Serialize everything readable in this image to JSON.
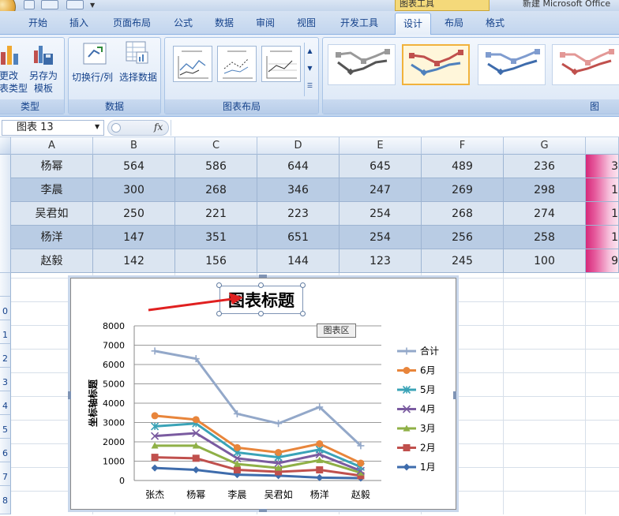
{
  "window": {
    "doc_title_fragment": "图表工具",
    "app_title_fragment": "新建 Microsoft Office"
  },
  "tabs": [
    {
      "label": "开始"
    },
    {
      "label": "插入"
    },
    {
      "label": "页面布局"
    },
    {
      "label": "公式"
    },
    {
      "label": "数据"
    },
    {
      "label": "审阅"
    },
    {
      "label": "视图"
    },
    {
      "label": "开发工具"
    },
    {
      "label": "设计",
      "active": true
    },
    {
      "label": "布局"
    },
    {
      "label": "格式"
    }
  ],
  "ribbon": {
    "type_group": {
      "label": "类型",
      "change_type_line1": "更改",
      "change_type_line2": "表类型",
      "save_template_line1": "另存为",
      "save_template_line2": "模板"
    },
    "data_group": {
      "label": "数据",
      "switch_row_col": "切换行/列",
      "select_data": "选择数据"
    },
    "layout_group": {
      "label": "图表布局"
    },
    "style_group": {
      "label_fragment": "图"
    }
  },
  "formula_bar": {
    "name_box": "图表 13",
    "fx": "fx"
  },
  "sheet": {
    "columns": [
      "A",
      "B",
      "C",
      "D",
      "E",
      "F",
      "G"
    ],
    "row_numbers": [
      "0",
      "1",
      "2",
      "3",
      "4",
      "5",
      "6",
      "7",
      "8"
    ],
    "rows": [
      {
        "name": "杨幂",
        "values": [
          "564",
          "586",
          "644",
          "645",
          "489",
          "236"
        ],
        "partial": "3"
      },
      {
        "name": "李晨",
        "values": [
          "300",
          "268",
          "346",
          "247",
          "269",
          "298"
        ],
        "partial": "1"
      },
      {
        "name": "吴君如",
        "values": [
          "250",
          "221",
          "223",
          "254",
          "268",
          "274"
        ],
        "partial": "1"
      },
      {
        "name": "杨洋",
        "values": [
          "147",
          "351",
          "651",
          "254",
          "256",
          "258"
        ],
        "partial": "1"
      },
      {
        "name": "赵毅",
        "values": [
          "142",
          "156",
          "144",
          "123",
          "245",
          "100"
        ],
        "partial": "9"
      }
    ]
  },
  "chart_tooltip": "图表区",
  "chart_data": {
    "type": "line",
    "title": "图表标题",
    "xlabel": "",
    "ylabel": "坐标轴标题",
    "ylim": [
      0,
      8000
    ],
    "yticks": [
      "0",
      "1000",
      "2000",
      "3000",
      "4000",
      "5000",
      "6000",
      "7000",
      "8000"
    ],
    "categories": [
      "张杰",
      "杨幂",
      "李晨",
      "吴君如",
      "杨洋",
      "赵毅"
    ],
    "grid": true,
    "legend": "right",
    "series": [
      {
        "name": "合计",
        "color": "#93a8c9",
        "marker": "plus",
        "values": [
          6700,
          6300,
          3450,
          2950,
          3800,
          1800
        ]
      },
      {
        "name": "6月",
        "color": "#e8853b",
        "marker": "circle",
        "values": [
          3350,
          3150,
          1700,
          1450,
          1900,
          900
        ]
      },
      {
        "name": "5月",
        "color": "#3aa3b7",
        "marker": "star",
        "values": [
          2800,
          2950,
          1450,
          1200,
          1600,
          700
        ]
      },
      {
        "name": "4月",
        "color": "#7a5ba0",
        "marker": "x",
        "values": [
          2300,
          2450,
          1150,
          900,
          1350,
          500
        ]
      },
      {
        "name": "3月",
        "color": "#8fb046",
        "marker": "triangle",
        "values": [
          1800,
          1800,
          850,
          650,
          1050,
          400
        ]
      },
      {
        "name": "2月",
        "color": "#c0504d",
        "marker": "square",
        "values": [
          1200,
          1150,
          550,
          450,
          550,
          250
        ]
      },
      {
        "name": "1月",
        "color": "#3e6cac",
        "marker": "diamond",
        "values": [
          650,
          550,
          300,
          250,
          150,
          120
        ]
      }
    ]
  }
}
